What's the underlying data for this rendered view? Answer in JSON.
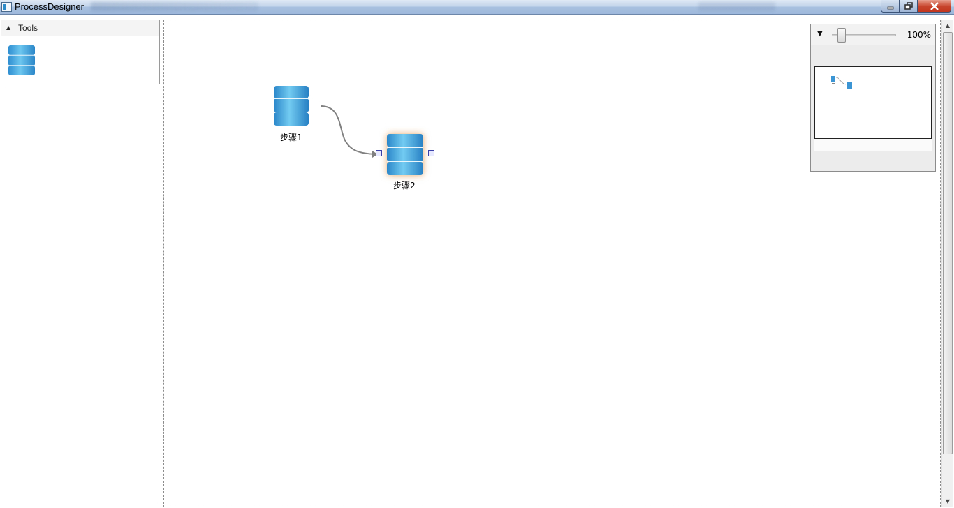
{
  "window": {
    "title": "ProcessDesigner"
  },
  "tools": {
    "header": "Tools",
    "items": [
      {
        "icon": "database-icon"
      }
    ]
  },
  "canvas": {
    "nodes": [
      {
        "label": "步骤1",
        "icon": "database-icon",
        "selected": false
      },
      {
        "label": "步骤2",
        "icon": "database-icon",
        "selected": true
      }
    ],
    "connections": [
      {
        "from": "步骤1",
        "to": "步骤2"
      }
    ]
  },
  "zoom": {
    "value_text": "100%",
    "level": 1.0
  },
  "colors": {
    "node_blue": "#2f8ed0",
    "connector": "#808080",
    "port_border": "#3b3fa8"
  }
}
